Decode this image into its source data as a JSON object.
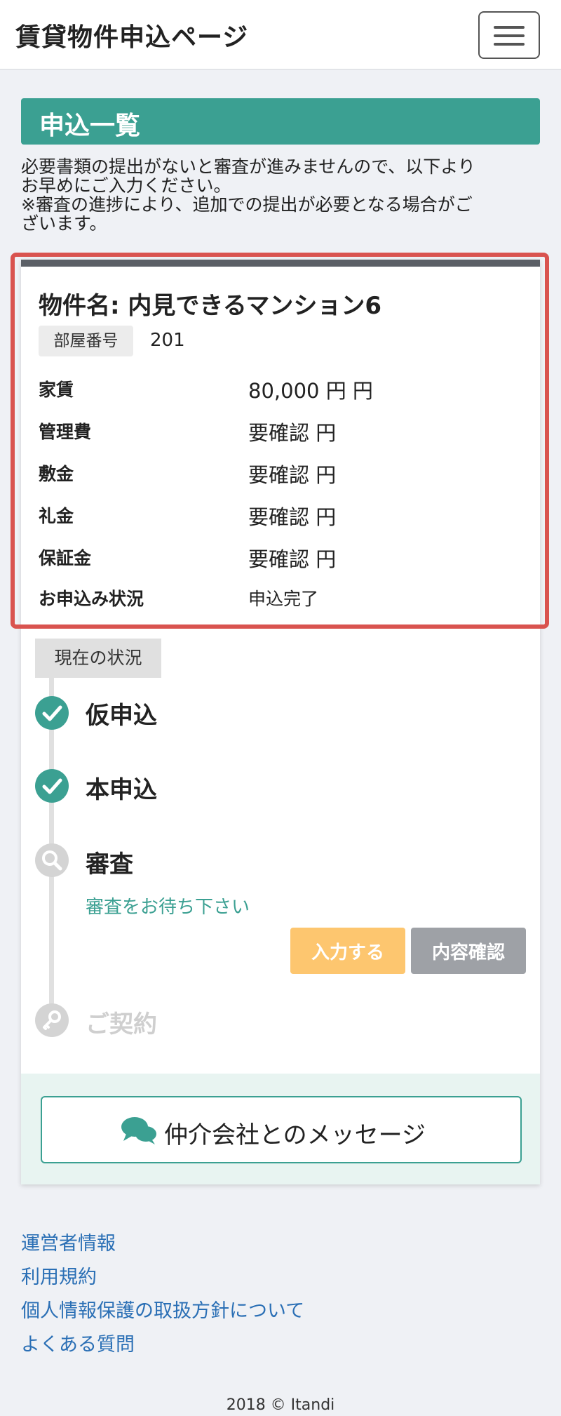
{
  "header": {
    "title": "賃貸物件申込ページ",
    "menu_icon": "hamburger-menu-icon"
  },
  "section": {
    "title": "申込一覧",
    "notice_line1": "必要書類の提出がないと審査が進みませんので、以下より",
    "notice_line2": "お早めにご入力ください。",
    "notice_line3": "※審査の進捗により、追加での提出が必要となる場合がご",
    "notice_line4": "ざいます。"
  },
  "property": {
    "name": "物件名: 内見できるマンション6",
    "room_label": "部屋番号",
    "room_number": "201",
    "rows": [
      {
        "label": "家賃",
        "value": "80,000 円 円"
      },
      {
        "label": "管理費",
        "value": "要確認 円"
      },
      {
        "label": "敷金",
        "value": "要確認 円"
      },
      {
        "label": "礼金",
        "value": "要確認 円"
      },
      {
        "label": "保証金",
        "value": "要確認 円"
      },
      {
        "label": "お申込み状況",
        "value": "申込完了"
      }
    ]
  },
  "status": {
    "tag": "現在の状況",
    "steps": [
      {
        "label": "仮申込",
        "state": "done",
        "icon": "check-icon"
      },
      {
        "label": "本申込",
        "state": "done",
        "icon": "check-icon"
      },
      {
        "label": "審査",
        "state": "current",
        "icon": "search-icon"
      },
      {
        "label": "ご契約",
        "state": "todo",
        "icon": "key-icon"
      }
    ],
    "review_message": "審査をお待ち下さい",
    "input_button": "入力する",
    "confirm_button": "内容確認"
  },
  "message_button": {
    "label": "仲介会社とのメッセージ",
    "icon": "chat-bubbles-icon"
  },
  "footer": {
    "links": [
      "運営者情報",
      "利用規約",
      "個人情報保護の取扱方針について",
      "よくある質問"
    ],
    "copyright": "2018 © Itandi"
  },
  "colors": {
    "accent": "#3ba092",
    "highlight": "#d9534f",
    "warning": "#fdc66f",
    "link": "#2a6fb5"
  }
}
